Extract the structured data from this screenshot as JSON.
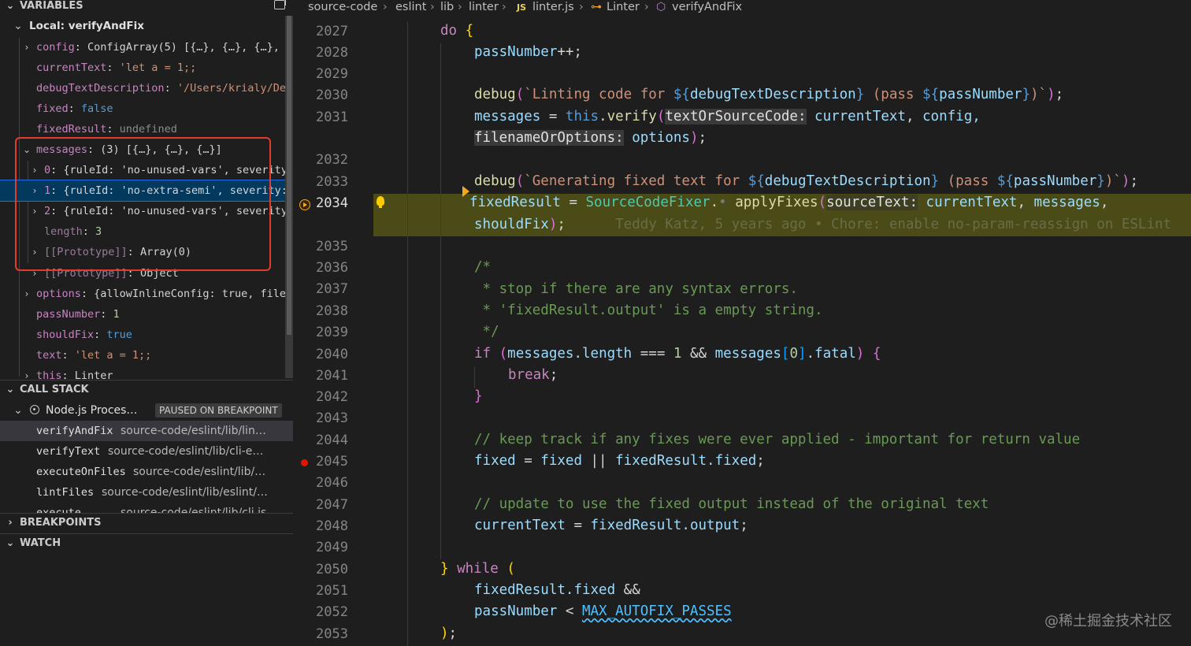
{
  "sidebar": {
    "variables_header": "VARIABLES",
    "scope": "Local: verifyAndFix",
    "vars": [
      {
        "name": "config",
        "value": "ConfigArray(5) [{…}, {…}, {…}, {…"
      },
      {
        "name": "currentText",
        "value": "'let a = 1;;"
      },
      {
        "name": "debugTextDescription",
        "value": "'/Users/krialy/Des…"
      },
      {
        "name": "fixed",
        "value": "false"
      },
      {
        "name": "fixedResult",
        "value": "undefined"
      },
      {
        "name": "messages",
        "value": "(3) [{…}, {…}, {…}]"
      },
      {
        "name": "0",
        "value": "{ruleId: 'no-unused-vars', severity:…"
      },
      {
        "name": "1",
        "value": "{ruleId: 'no-extra-semi', severity:…"
      },
      {
        "name": "2",
        "value": "{ruleId: 'no-unused-vars', severity:…"
      },
      {
        "name": "length",
        "value": "3"
      },
      {
        "name": "[[Prototype]]",
        "value": "Array(0)"
      },
      {
        "name": "[[Prototype]]",
        "value": "Object"
      },
      {
        "name": "options",
        "value": "{allowInlineConfig: true, filen…"
      },
      {
        "name": "passNumber",
        "value": "1"
      },
      {
        "name": "shouldFix",
        "value": "true"
      },
      {
        "name": "text",
        "value": "'let a = 1;;"
      },
      {
        "name": "this",
        "value": "Linter"
      }
    ],
    "call_stack_header": "CALL STACK",
    "process": {
      "label": "Node.js Proces…",
      "badge": "PAUSED ON BREAKPOINT"
    },
    "frames": [
      {
        "fn": "verifyAndFix",
        "src": "source-code/eslint/lib/lin…"
      },
      {
        "fn": "verifyText",
        "src": "source-code/eslint/lib/cli-e…"
      },
      {
        "fn": "executeOnFiles",
        "src": "source-code/eslint/lib/…"
      },
      {
        "fn": "lintFiles",
        "src": "source-code/eslint/lib/eslint/…"
      },
      {
        "fn": "execute",
        "src": "source-code/eslint/lib/cli.js"
      }
    ],
    "breakpoints_header": "BREAKPOINTS",
    "watch_header": "WATCH"
  },
  "breadcrumb": {
    "items": [
      "source-code",
      "eslint",
      "lib",
      "linter",
      "linter.js",
      "Linter",
      "verifyAndFix"
    ],
    "js_badge": "JS"
  },
  "editor": {
    "line_numbers": [
      "2027",
      "2028",
      "2029",
      "2030",
      "2031",
      "2032",
      "2033",
      "2034",
      "2035",
      "2036",
      "2037",
      "2038",
      "2039",
      "2040",
      "2041",
      "2042",
      "2043",
      "2044",
      "2045",
      "2046",
      "2047",
      "2048",
      "2049",
      "2050",
      "2051",
      "2052",
      "2053"
    ],
    "current_line": "2034",
    "breakpoint_line": "2045",
    "code": {
      "l2027_do": "do",
      "l2028_a": "passNumber",
      "l2028_b": "++;",
      "l2030_fn": "debug",
      "l2030_s1": "`Linting code for ",
      "l2030_v1": "debugTextDescription",
      "l2030_s2": " (pass ",
      "l2030_v2": "passNumber",
      "l2030_s3": ")`",
      "l2031_v": "messages",
      "l2031_this": "this",
      "l2031_fn": "verify",
      "l2031_hint": "textOrSourceCode:",
      "l2031_a1": " currentText",
      "l2031_a2": " config,",
      "l2031b_hint": "filenameOrOptions:",
      "l2031b_a": " options",
      "l2033_fn": "debug",
      "l2033_s1": "`Generating fixed text for ",
      "l2033_v1": "debugTextDescription",
      "l2033_s2": " (pass ",
      "l2033_v2": "passNumber",
      "l2033_s3": ")`",
      "l2034_v": "fixedResult",
      "l2034_cls": "SourceCodeFixer",
      "l2034_fn": "applyFixes",
      "l2034_hint": "sourceText:",
      "l2034_a1": " currentText",
      "l2034_a2": " messages",
      "l2034b_v": "shouldFix",
      "blame": "Teddy Katz, 5 years ago • Chore: enable no-param-reassign on ESLint",
      "l2036": "/*",
      "l2037": " * stop if there are any syntax errors.",
      "l2038": " * 'fixedResult.output' is a empty string.",
      "l2039": " */",
      "l2040_if": "if",
      "l2040_v": "messages",
      "l2040_p": ".length",
      "l2040_n": "1",
      "l2040_v2": "messages",
      "l2040_n2": "0",
      "l2040_p2": ".fatal",
      "l2041_break": "break",
      "l2044": "// keep track if any fixes were ever applied - important for return value",
      "l2045_a": "fixed",
      "l2045_b": "fixed",
      "l2045_c": "fixedResult",
      "l2045_d": ".fixed",
      "l2047": "// update to use the fixed output instead of the original text",
      "l2048_a": "currentText",
      "l2048_b": "fixedResult",
      "l2048_c": ".output",
      "l2050_while": "while",
      "l2051_a": "fixedResult",
      "l2051_b": ".fixed",
      "l2052_a": "passNumber",
      "l2052_c": "MAX_AUTOFIX_PASSES"
    }
  },
  "watermark": "@稀土掘金技术社区",
  "colors": {
    "accent_selection": "#04395e",
    "current_line_bg": "#4b4b18",
    "annotation_box": "#e33b2e",
    "breakpoint": "#e51400"
  }
}
